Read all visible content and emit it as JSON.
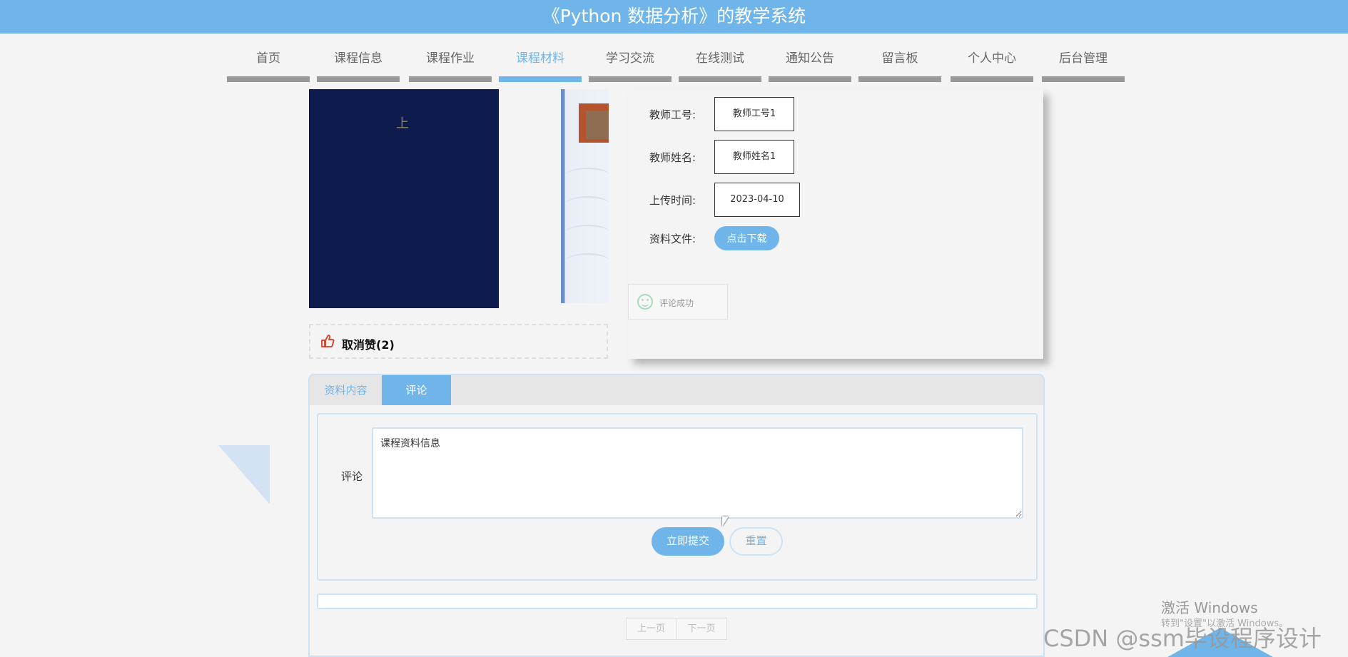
{
  "header": {
    "title": "《Python 数据分析》的教学系统"
  },
  "nav": {
    "items": [
      {
        "label": "首页",
        "active": false
      },
      {
        "label": "课程信息",
        "active": false
      },
      {
        "label": "课程作业",
        "active": false
      },
      {
        "label": "课程材料",
        "active": true
      },
      {
        "label": "学习交流",
        "active": false
      },
      {
        "label": "在线测试",
        "active": false
      },
      {
        "label": "通知公告",
        "active": false
      },
      {
        "label": "留言板",
        "active": false
      },
      {
        "label": "个人中心",
        "active": false
      },
      {
        "label": "后台管理",
        "active": false
      }
    ]
  },
  "book_images": {
    "cover1_char": "上"
  },
  "info": {
    "teacher_id_label": "教师工号:",
    "teacher_id_value": "教师工号1",
    "teacher_name_label": "教师姓名:",
    "teacher_name_value": "教师姓名1",
    "upload_time_label": "上传时间:",
    "upload_time_value": "2023-04-10",
    "file_label": "资料文件:",
    "download_button": "点击下载"
  },
  "toast": {
    "message": "评论成功"
  },
  "like": {
    "label": "取消赞(2)"
  },
  "tabs": {
    "content_tab": "资料内容",
    "comment_tab": "评论",
    "active": "评论"
  },
  "comment_form": {
    "label": "评论",
    "textarea_value": "课程资料信息",
    "submit_button": "立即提交",
    "reset_button": "重置"
  },
  "pager": {
    "prev": "上一页",
    "next": "下一页"
  },
  "watermarks": {
    "activate_title": "激活 Windows",
    "activate_sub": "转到\"设置\"以激活 Windows。",
    "csdn": "CSDN @ssm毕设程序设计"
  },
  "colors": {
    "accent": "#6fb5ea",
    "border_light": "#cde3f5",
    "background": "#f4f4f4"
  }
}
